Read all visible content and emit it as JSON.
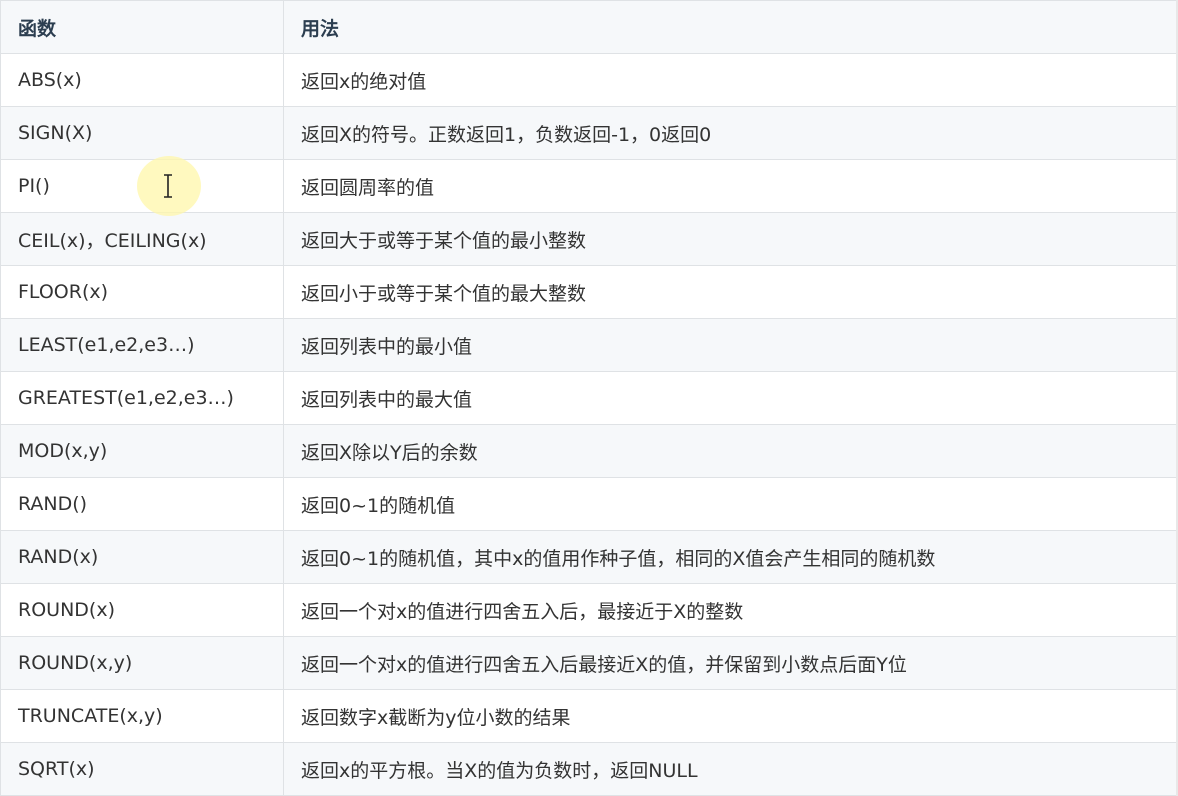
{
  "table": {
    "headers": {
      "function": "函数",
      "usage": "用法"
    },
    "rows": [
      {
        "function": "ABS(x)",
        "usage": "返回x的绝对值"
      },
      {
        "function": "SIGN(X)",
        "usage": "返回X的符号。正数返回1，负数返回-1，0返回0"
      },
      {
        "function": "PI()",
        "usage": "返回圆周率的值"
      },
      {
        "function": "CEIL(x)，CEILING(x)",
        "usage": "返回大于或等于某个值的最小整数"
      },
      {
        "function": "FLOOR(x)",
        "usage": "返回小于或等于某个值的最大整数"
      },
      {
        "function": "LEAST(e1,e2,e3…)",
        "usage": "返回列表中的最小值"
      },
      {
        "function": "GREATEST(e1,e2,e3…)",
        "usage": "返回列表中的最大值"
      },
      {
        "function": "MOD(x,y)",
        "usage": "返回X除以Y后的余数"
      },
      {
        "function": "RAND()",
        "usage": "返回0~1的随机值"
      },
      {
        "function": "RAND(x)",
        "usage": "返回0~1的随机值，其中x的值用作种子值，相同的X值会产生相同的随机数"
      },
      {
        "function": "ROUND(x)",
        "usage": "返回一个对x的值进行四舍五入后，最接近于X的整数"
      },
      {
        "function": "ROUND(x,y)",
        "usage": "返回一个对x的值进行四舍五入后最接近X的值，并保留到小数点后面Y位"
      },
      {
        "function": "TRUNCATE(x,y)",
        "usage": "返回数字x截断为y位小数的结果"
      },
      {
        "function": "SQRT(x)",
        "usage": "返回x的平方根。当X的值为负数时，返回NULL"
      }
    ]
  },
  "cursor": {
    "icon": "text-cursor-icon",
    "highlight_color": "#fff7aa"
  },
  "colors": {
    "border": "#dfe2e5",
    "stripe": "#f6f8fa",
    "header_text": "#2c3e50",
    "body_text": "#333333"
  }
}
